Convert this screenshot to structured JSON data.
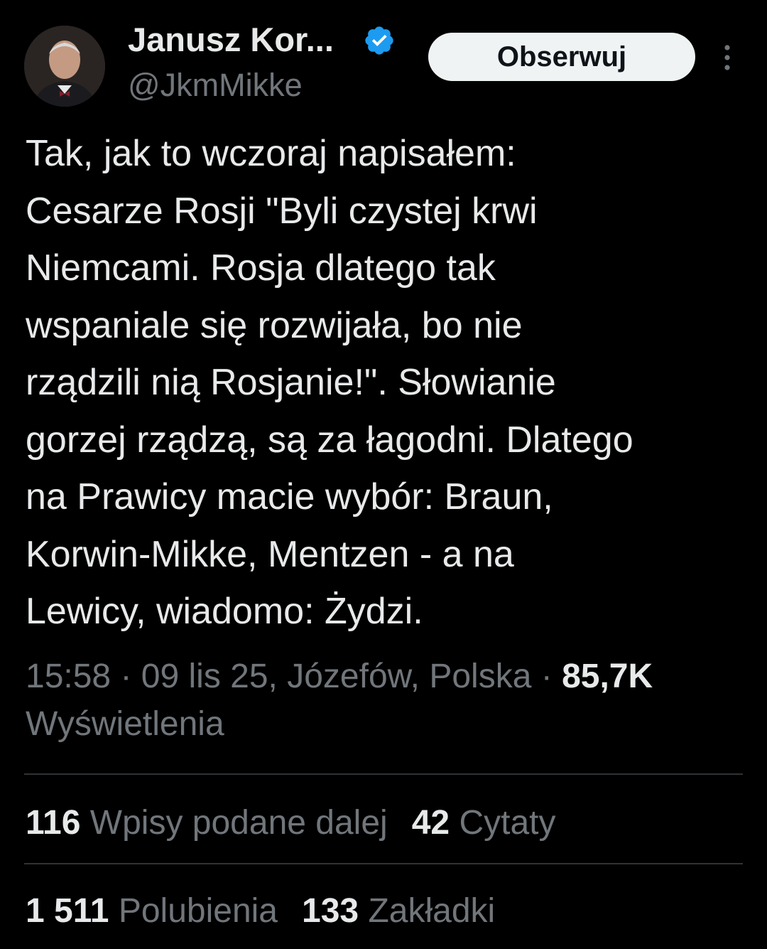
{
  "author": {
    "display_name": "Janusz Kor...",
    "handle": "@JkmMikke",
    "verified_color": "#1d9bf0"
  },
  "follow_button": {
    "label": "Obserwuj"
  },
  "more_icon": "more-vertical-icon",
  "tweet": {
    "text": "Tak, jak to wczoraj napisałem:\nCesarze Rosji \"Byli czystej krwi\nNiemcami. Rosja dlatego tak\nwspaniale się rozwijała, bo nie\nrządzili nią Rosjanie!\". Słowianie\ngorzej rządzą, są za łagodni. Dlatego\nna Prawicy macie wybór: Braun,\nKorwin-Mikke, Mentzen - a na\nLewicy, wiadomo: Żydzi."
  },
  "meta": {
    "time_place": "15:58 · 09 lis 25, Józefów, Polska · ",
    "views_count": "85,7K",
    "views_label": "Wyświetlenia"
  },
  "stats": {
    "reposts_count": "116",
    "reposts_label": "Wpisy podane dalej",
    "quotes_count": "42",
    "quotes_label": "Cytaty",
    "likes_count": "1 511",
    "likes_label": "Polubienia",
    "bookmarks_count": "133",
    "bookmarks_label": "Zakładki"
  },
  "colors": {
    "background": "#000000",
    "text_primary": "#e7e9ea",
    "text_secondary": "#71767b",
    "divider": "#2f3336",
    "button_bg": "#eff3f4"
  }
}
